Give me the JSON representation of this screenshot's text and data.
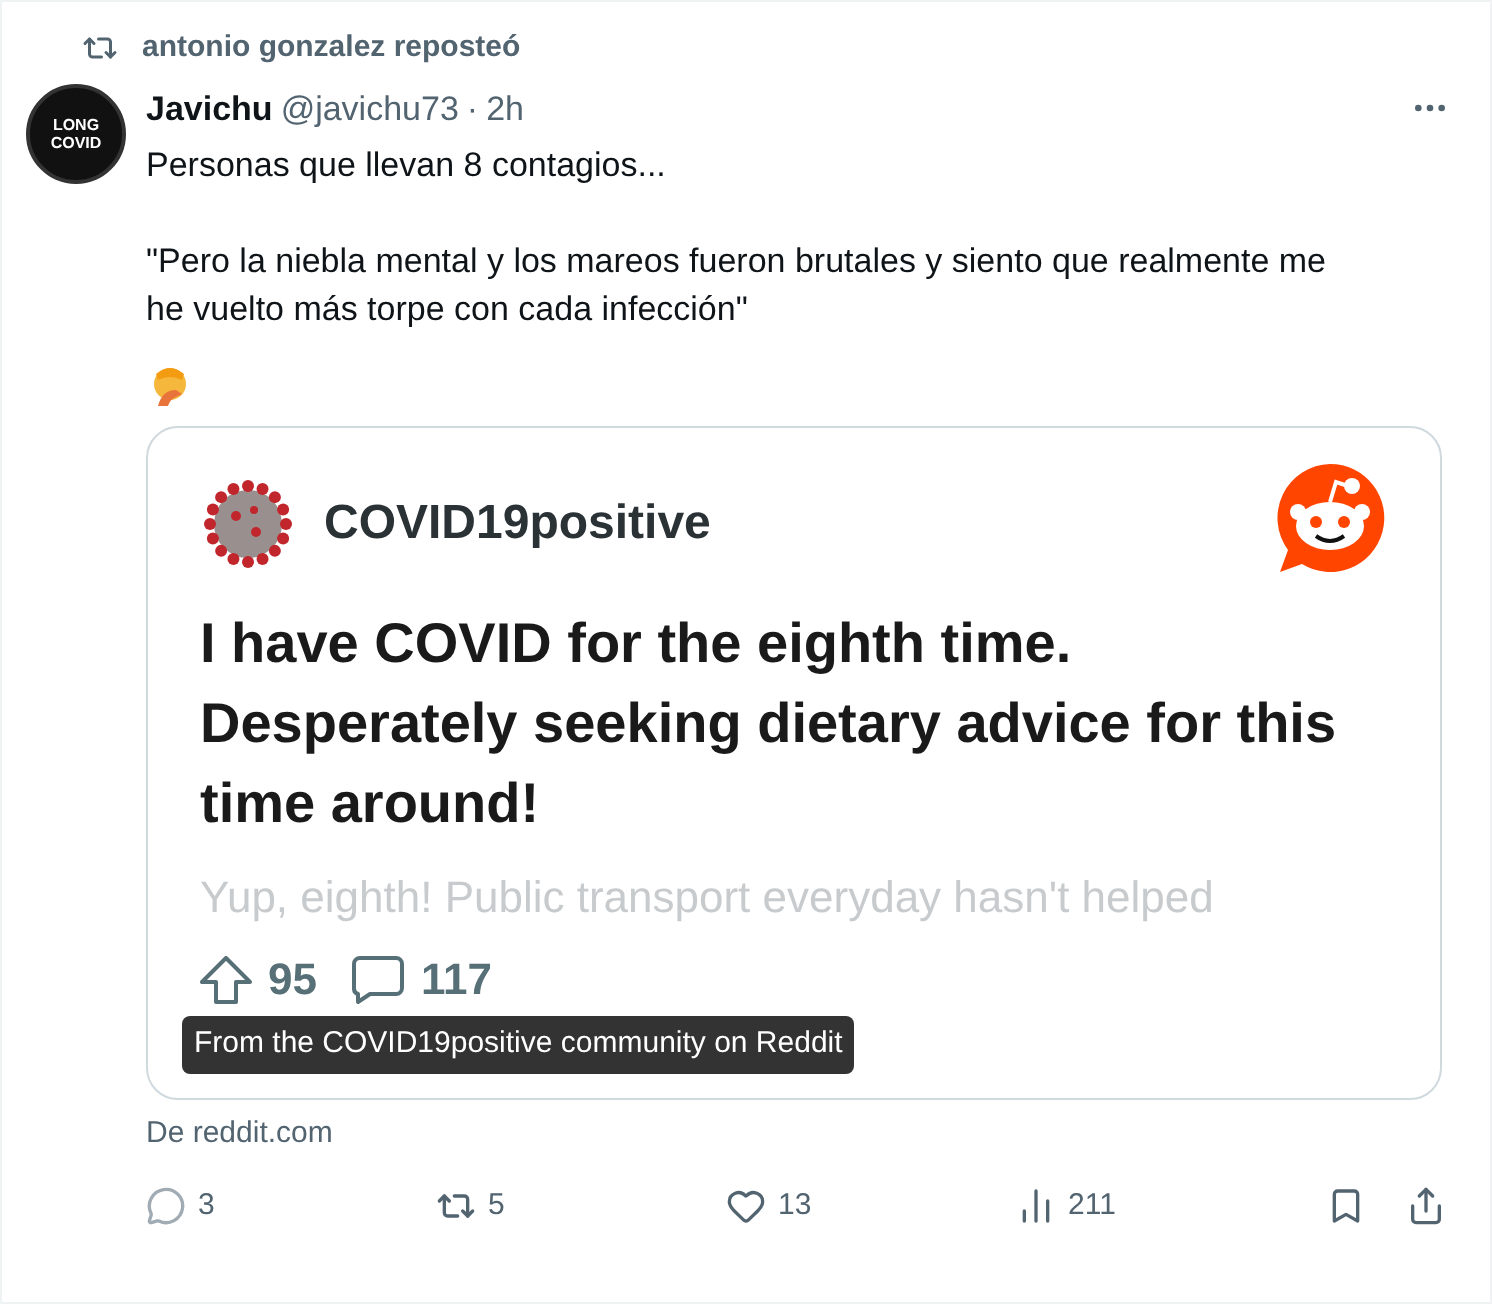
{
  "repost": {
    "label": "antonio gonzalez reposteó"
  },
  "author": {
    "name": "Javichu",
    "handle": "@javichu73",
    "separator": "·",
    "time": "2h",
    "avatar_text": [
      "LONG",
      "COVID"
    ]
  },
  "text": {
    "paragraphs": [
      "Personas que llevan 8 contagios...",
      "\"Pero la niebla mental y los mareos fueron brutales y siento que realmente me he vuelto más torpe con cada infección\""
    ]
  },
  "card": {
    "community": "COVID19positive",
    "title": "I have COVID for the eighth time. Desperately seeking dietary advice for this time around!",
    "excerpt": "Yup, eighth! Public transport everyday hasn't helped",
    "upvotes": "95",
    "comments": "117",
    "tooltip": "From the COVID19positive community on Reddit"
  },
  "source": "De reddit.com",
  "actions": [
    {
      "kind": "reply",
      "count": "3"
    },
    {
      "kind": "repost",
      "count": "5"
    },
    {
      "kind": "like",
      "count": "13"
    },
    {
      "kind": "views",
      "count": "211"
    }
  ]
}
